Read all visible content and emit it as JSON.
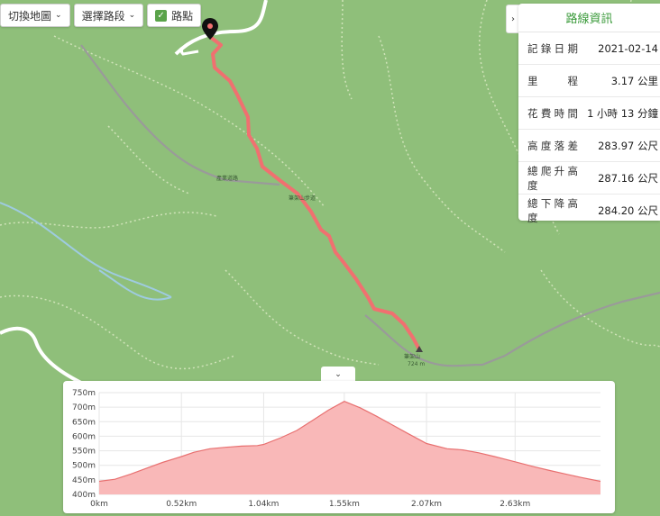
{
  "toolbar": {
    "switch_map": "切換地圖",
    "select_segment": "選擇路段",
    "waypoints": "路點",
    "waypoints_checked": true
  },
  "panel": {
    "toggle_icon": "chevron-right-icon",
    "title": "路線資訊",
    "rows": [
      {
        "label": "記錄日期",
        "value": "2021-02-14"
      },
      {
        "label": "里程",
        "value": "3.17 公里"
      },
      {
        "label": "花費時間",
        "value": "1 小時 13 分鐘"
      },
      {
        "label": "高度落差",
        "value": "283.97 公尺"
      },
      {
        "label": "總爬升高度",
        "value": "287.16 公尺"
      },
      {
        "label": "總下降高度",
        "value": "284.20 公尺"
      }
    ]
  },
  "map": {
    "labels": {
      "summit_name": "筆架山",
      "summit_elev": "724 m",
      "road_left": "產業道路",
      "road_mid": "筆架山步道"
    },
    "colors": {
      "track": "#f07070",
      "marker": "#111111"
    }
  },
  "chart_data": {
    "type": "area",
    "ylabels": [
      "750m",
      "700m",
      "650m",
      "600m",
      "550m",
      "500m",
      "450m",
      "400m"
    ],
    "xlabels": [
      "0km",
      "0.52km",
      "1.04km",
      "1.55km",
      "2.07km",
      "2.63km"
    ],
    "ylim": [
      400,
      750
    ],
    "xlim": [
      0,
      3.17
    ],
    "x": [
      0,
      0.1,
      0.2,
      0.3,
      0.4,
      0.52,
      0.6,
      0.7,
      0.8,
      0.9,
      1.0,
      1.04,
      1.15,
      1.25,
      1.35,
      1.45,
      1.55,
      1.65,
      1.75,
      1.85,
      1.95,
      2.07,
      2.2,
      2.3,
      2.4,
      2.5,
      2.63,
      2.75,
      2.85,
      2.95,
      3.05,
      3.17
    ],
    "y": [
      445,
      452,
      470,
      490,
      510,
      530,
      545,
      557,
      562,
      566,
      568,
      572,
      595,
      620,
      655,
      690,
      720,
      698,
      670,
      640,
      610,
      575,
      557,
      553,
      543,
      530,
      512,
      495,
      482,
      470,
      458,
      445
    ],
    "fill": "#f9b8b8",
    "stroke": "#e87070"
  }
}
